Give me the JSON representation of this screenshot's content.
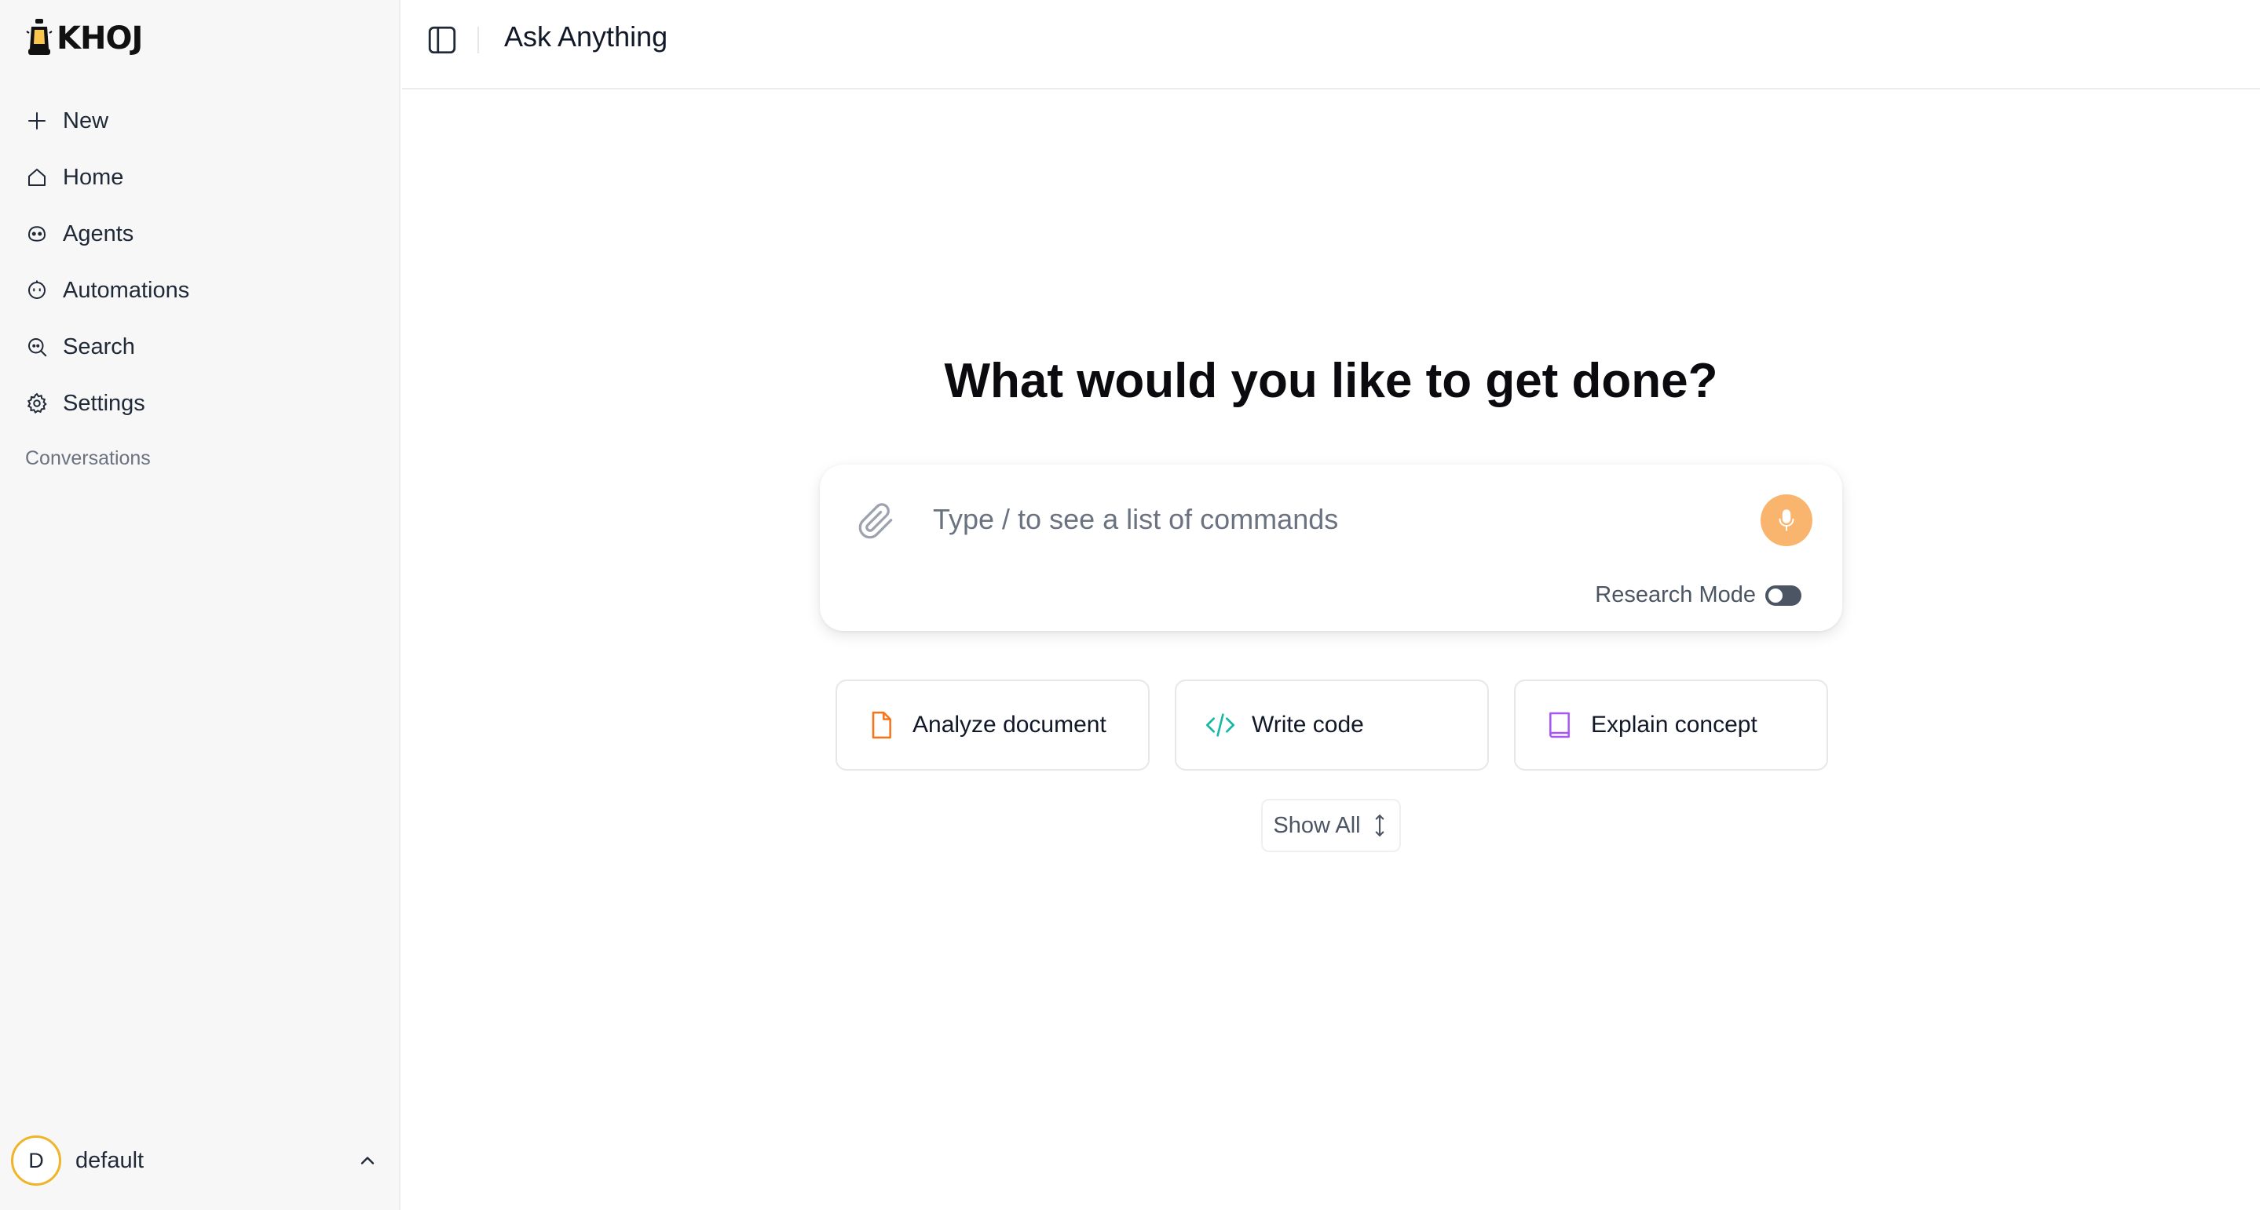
{
  "app": {
    "logo_text": "KHOJ",
    "accent_color": "#f9b46d"
  },
  "sidebar": {
    "items": [
      {
        "label": "New",
        "icon": "plus-icon"
      },
      {
        "label": "Home",
        "icon": "home-icon"
      },
      {
        "label": "Agents",
        "icon": "agent-icon"
      },
      {
        "label": "Automations",
        "icon": "automation-icon"
      },
      {
        "label": "Search",
        "icon": "search-icon"
      },
      {
        "label": "Settings",
        "icon": "gear-icon"
      }
    ],
    "conversations_label": "Conversations",
    "user": {
      "initial": "D",
      "name": "default"
    }
  },
  "header": {
    "title": "Ask Anything"
  },
  "main": {
    "headline": "What would you like to get done?",
    "input_placeholder": "Type / to see a list of commands",
    "research_mode_label": "Research Mode",
    "research_mode_enabled": false,
    "suggestions": [
      {
        "label": "Analyze document",
        "icon": "document-icon",
        "color": "#f97316"
      },
      {
        "label": "Write code",
        "icon": "code-icon",
        "color": "#14b8a6"
      },
      {
        "label": "Explain concept",
        "icon": "book-icon",
        "color": "#a855f7"
      }
    ],
    "show_all_label": "Show All"
  }
}
